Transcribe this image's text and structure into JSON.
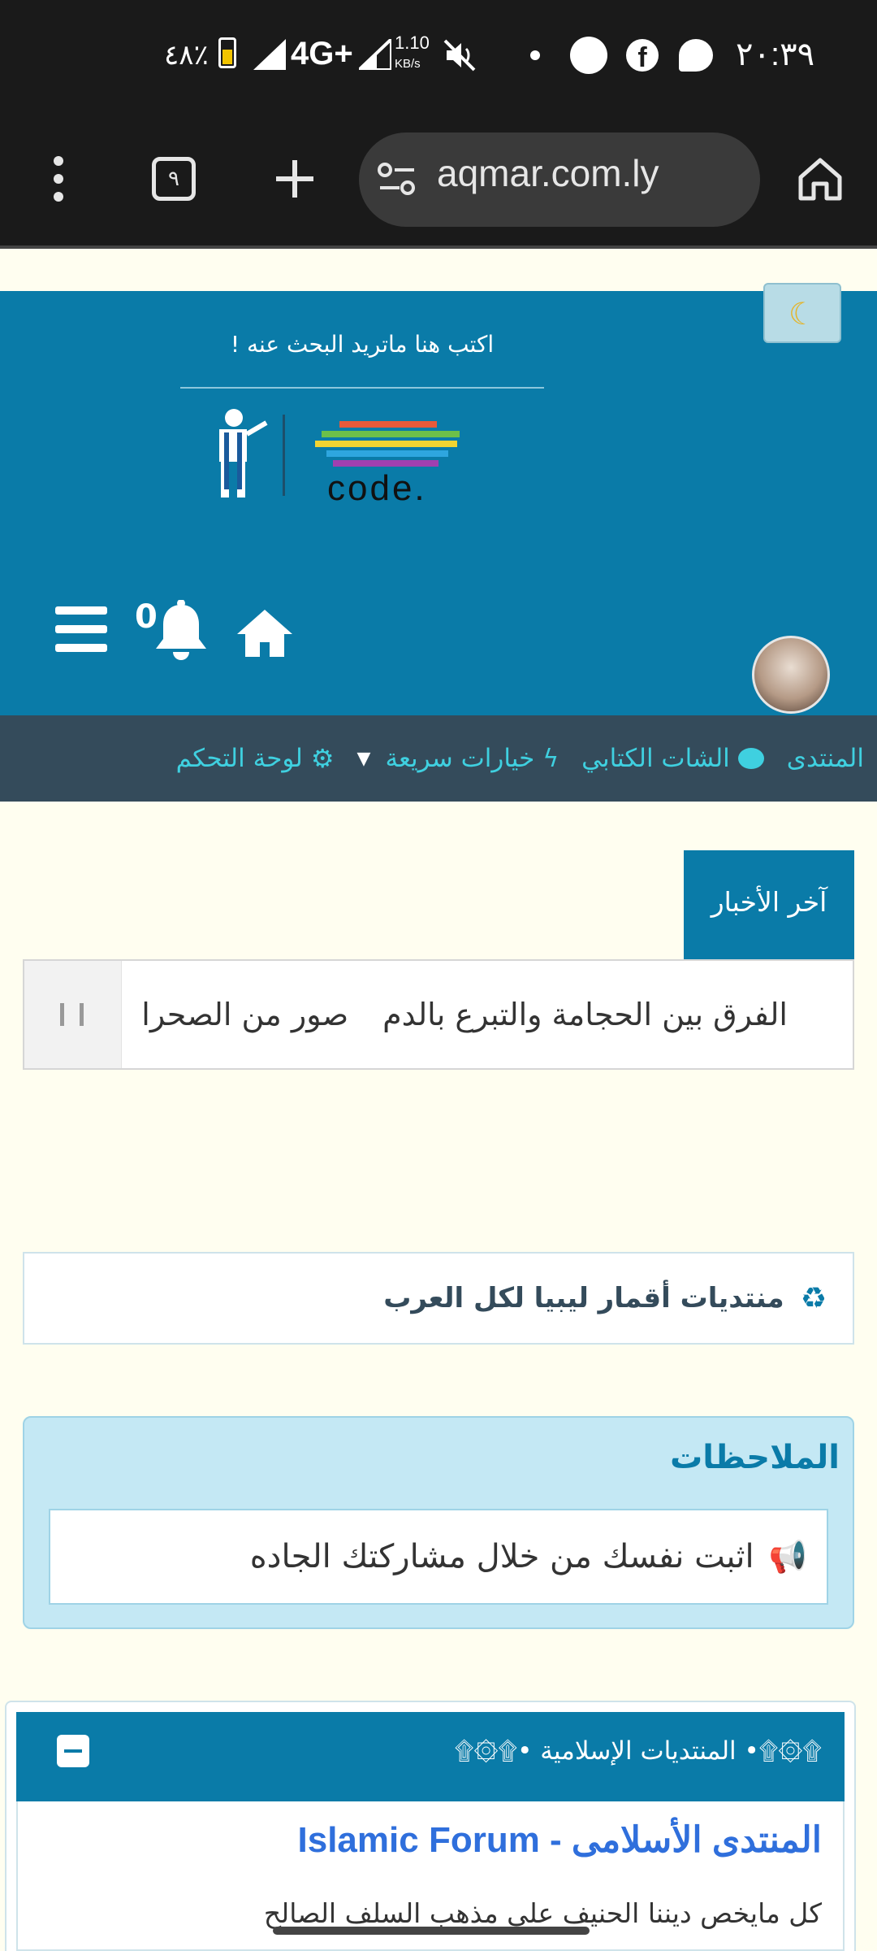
{
  "status_bar": {
    "time": "٢٠:٣٩",
    "battery": "٤٨٪",
    "network": "4G+",
    "speed_value": "1.10",
    "speed_unit": "KB/s"
  },
  "browser": {
    "url": "aqmar.com.ly",
    "tab_count": "٩"
  },
  "header": {
    "search_placeholder": "اكتب هنا ماتريد البحث عنه !",
    "logo_text": "code.",
    "notification_count": "0",
    "dark_mode_icon": "moon-icon"
  },
  "navbar": {
    "items": [
      {
        "label": "المنتدى"
      },
      {
        "label": "الشات الكتابي"
      },
      {
        "label": "خيارات سريعة"
      },
      {
        "label": "لوحة التحكم"
      }
    ]
  },
  "news": {
    "tab_label": "آخر الأخبار",
    "ticker": [
      "الفرق بين الحجامة والتبرع بالدم",
      "صور من الصحرا"
    ]
  },
  "banner": {
    "title": "منتديات أقمار ليبيا لكل العرب"
  },
  "notes": {
    "heading": "الملاحظات",
    "text": "اثبت نفسك من خلال مشاركتك الجاده"
  },
  "category": {
    "header": "۩۞۩• المنتديات الإسلامية •۩۞۩",
    "forum_title": "المنتدى الأسلامى - Islamic Forum",
    "forum_desc": "كل مايخص ديننا الحنيف على مذهب السلف الصالح"
  },
  "colors": {
    "header_blue": "#0a7ba8",
    "navbar": "#344b5b",
    "nav_link": "#3fd0e0",
    "page_bg": "#fffef0",
    "forum_title": "#2f6fdc"
  }
}
